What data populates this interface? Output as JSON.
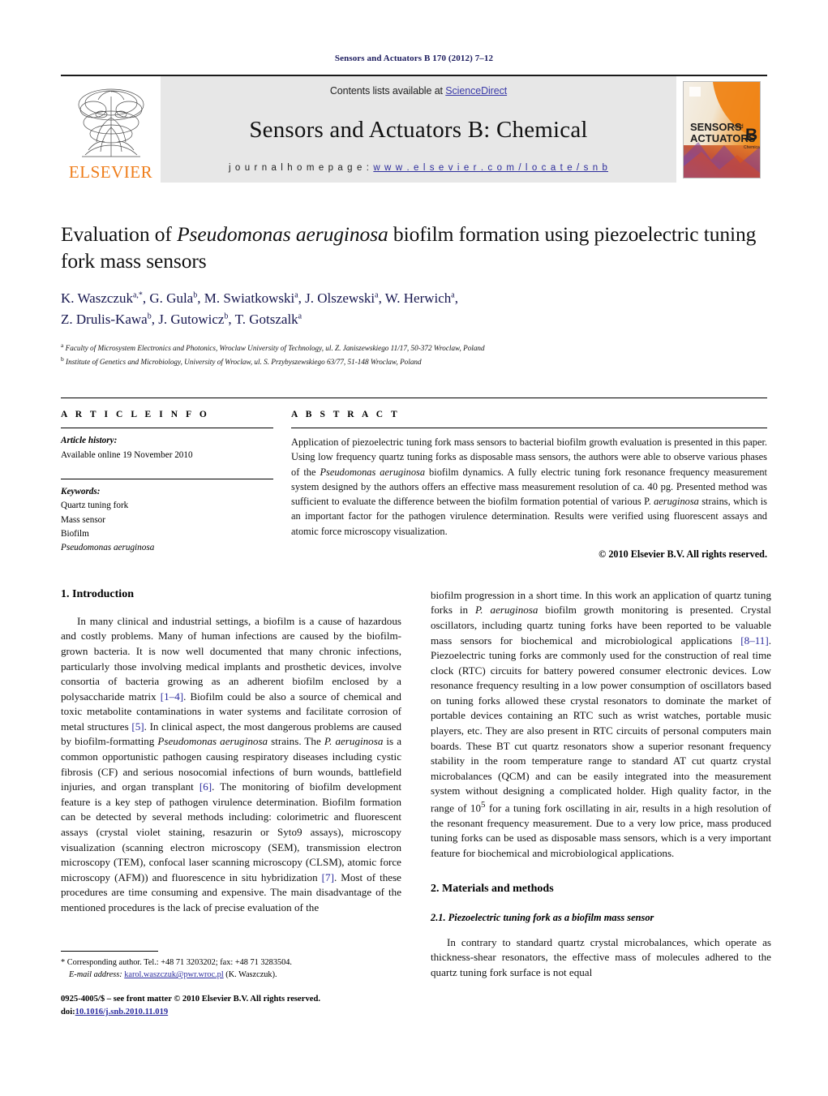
{
  "running_head": "Sensors and Actuators B 170 (2012) 7–12",
  "masthead": {
    "contents_prefix": "Contents lists available at ",
    "sciencedirect": "ScienceDirect",
    "journal_title": "Sensors and Actuators B: Chemical",
    "homepage_prefix": "j o u r n a l   h o m e p a g e :   ",
    "homepage_url": "w w w . e l s e v i e r . c o m / l o c a t e / s n b",
    "publisher": "ELSEVIER",
    "cover_line1": "SENSORS",
    "cover_and": "and",
    "cover_line2": "ACTUATORS",
    "cover_letter": "B",
    "cover_sub": "Chemical",
    "accent_orange": "#ef7d1a",
    "link_blue": "#3b3ba8"
  },
  "article": {
    "title_pre": "Evaluation of ",
    "title_italic": "Pseudomonas aeruginosa",
    "title_post": " biofilm formation using piezoelectric tuning fork mass sensors",
    "authors_line1": "K. Waszczuk",
    "authors": "K. Waszczuk a,*, G. Gula b, M. Swiatkowski a, J. Olszewski a, W. Herwich a, Z. Drulis-Kawa b, J. Gutowicz b, T. Gotszalk a",
    "affiliation_a": "Faculty of Microsystem Electronics and Photonics, Wroclaw University of Technology, ul. Z. Janiszewskiego 11/17, 50-372 Wroclaw, Poland",
    "affiliation_b": "Institute of Genetics and Microbiology, University of Wroclaw, ul. S. Przybyszewskiego 63/77, 51-148 Wroclaw, Poland"
  },
  "article_info": {
    "heading": "A R T I C L E   I N F O",
    "history_label": "Article history:",
    "history_value": "Available online 19 November 2010",
    "keywords_label": "Keywords:",
    "keywords": [
      "Quartz tuning fork",
      "Mass sensor",
      "Biofilm",
      "Pseudomonas aeruginosa"
    ]
  },
  "abstract": {
    "heading": "A B S T R A C T",
    "part1": "Application of piezoelectric tuning fork mass sensors to bacterial biofilm growth evaluation is presented in this paper. Using low frequency quartz tuning forks as disposable mass sensors, the authors were able to observe various phases of the ",
    "species1": "Pseudomonas aeruginosa",
    "part2": " biofilm dynamics. A fully electric tuning fork resonance frequency measurement system designed by the authors offers an effective mass measurement resolution of ca. 40 pg. Presented method was sufficient to evaluate the difference between the biofilm formation potential of various P. ",
    "species2": "aeruginosa",
    "part3": " strains, which is an important factor for the pathogen virulence determination. Results were verified using fluorescent assays and atomic force microscopy visualization.",
    "copyright": "© 2010 Elsevier B.V. All rights reserved."
  },
  "sections": {
    "introduction_heading": "1. Introduction",
    "materials_heading": "2. Materials and methods",
    "subsection_2_1": "2.1. Piezoelectric tuning fork as a biofilm mass sensor"
  },
  "body": {
    "left_p1_a": "In many clinical and industrial settings, a biofilm is a cause of hazardous and costly problems. Many of human infections are caused by the biofilm-grown bacteria. It is now well documented that many chronic infections, particularly those involving medical implants and prosthetic devices, involve consortia of bacteria growing as an adherent biofilm enclosed by a polysaccharide matrix ",
    "ref_1_4": "[1–4]",
    "left_p1_b": ". Biofilm could be also a source of chemical and toxic metabolite contaminations in water systems and facilitate corrosion of metal structures ",
    "ref_5": "[5]",
    "left_p1_c": ". In clinical aspect, the most dangerous problems are caused by biofilm-formatting ",
    "species_pa": "Pseudomonas aeruginosa",
    "left_p1_d": " strains. The ",
    "species_pa_short": "P. aeruginosa",
    "left_p1_e": " is a common opportunistic pathogen causing respiratory diseases including cystic fibrosis (CF) and serious nosocomial infections of burn wounds, battlefield injuries, and organ transplant ",
    "ref_6": "[6]",
    "left_p1_f": ". The monitoring of biofilm development feature is a key step of pathogen virulence determination. Biofilm formation can be detected by several methods including: colorimetric and fluorescent assays (crystal violet staining, resazurin or Syto9 assays), microscopy visualization (scanning electron microscopy (SEM), transmission electron microscopy (TEM), confocal laser scanning microscopy (CLSM), atomic force microscopy (AFM)) and fluorescence in situ hybridization ",
    "ref_7": "[7]",
    "left_p1_g": ". Most of these procedures are time consuming and expensive. The main disadvantage of the mentioned procedures is the lack of precise evaluation of the",
    "right_p1_a": "biofilm progression in a short time. In this work an application of quartz tuning forks in ",
    "right_species": "P. aeruginosa",
    "right_p1_b": " biofilm growth monitoring is presented. Crystal oscillators, including quartz tuning forks have been reported to be valuable mass sensors for biochemical and microbiological applications ",
    "ref_8_11": "[8–11]",
    "right_p1_c": ". Piezoelectric tuning forks are commonly used for the construction of real time clock (RTC) circuits for battery powered consumer electronic devices. Low resonance frequency resulting in a low power consumption of oscillators based on tuning forks allowed these crystal resonators to dominate the market of portable devices containing an RTC such as wrist watches, portable music players, etc. They are also present in RTC circuits of personal computers main boards. These BT cut quartz resonators show a superior resonant frequency stability in the room temperature range to standard AT cut quartz crystal microbalances (QCM) and can be easily integrated into the measurement system without designing a complicated holder. High quality factor, in the range of 10",
    "exp_5": "5",
    "right_p1_d": " for a tuning fork oscillating in air, results in a high resolution of the resonant frequency measurement. Due to a very low price, mass produced tuning forks can be used as disposable mass sensors, which is a very important feature for biochemical and microbiological applications.",
    "right_p2": "In contrary to standard quartz crystal microbalances, which operate as thickness-shear resonators, the effective mass of molecules adhered to the quartz tuning fork surface is not equal"
  },
  "footnote": {
    "marker": "*",
    "corresponding": " Corresponding author. Tel.: +48 71 3203202; fax: +48 71 3283504.",
    "email_label": "E-mail address:",
    "email": "karol.waszczuk@pwr.wroc.pl",
    "email_suffix": " (K. Waszczuk)."
  },
  "footer": {
    "front_matter": "0925-4005/$ – see front matter © 2010 Elsevier B.V. All rights reserved.",
    "doi_label": "doi:",
    "doi": "10.1016/j.snb.2010.11.019"
  }
}
